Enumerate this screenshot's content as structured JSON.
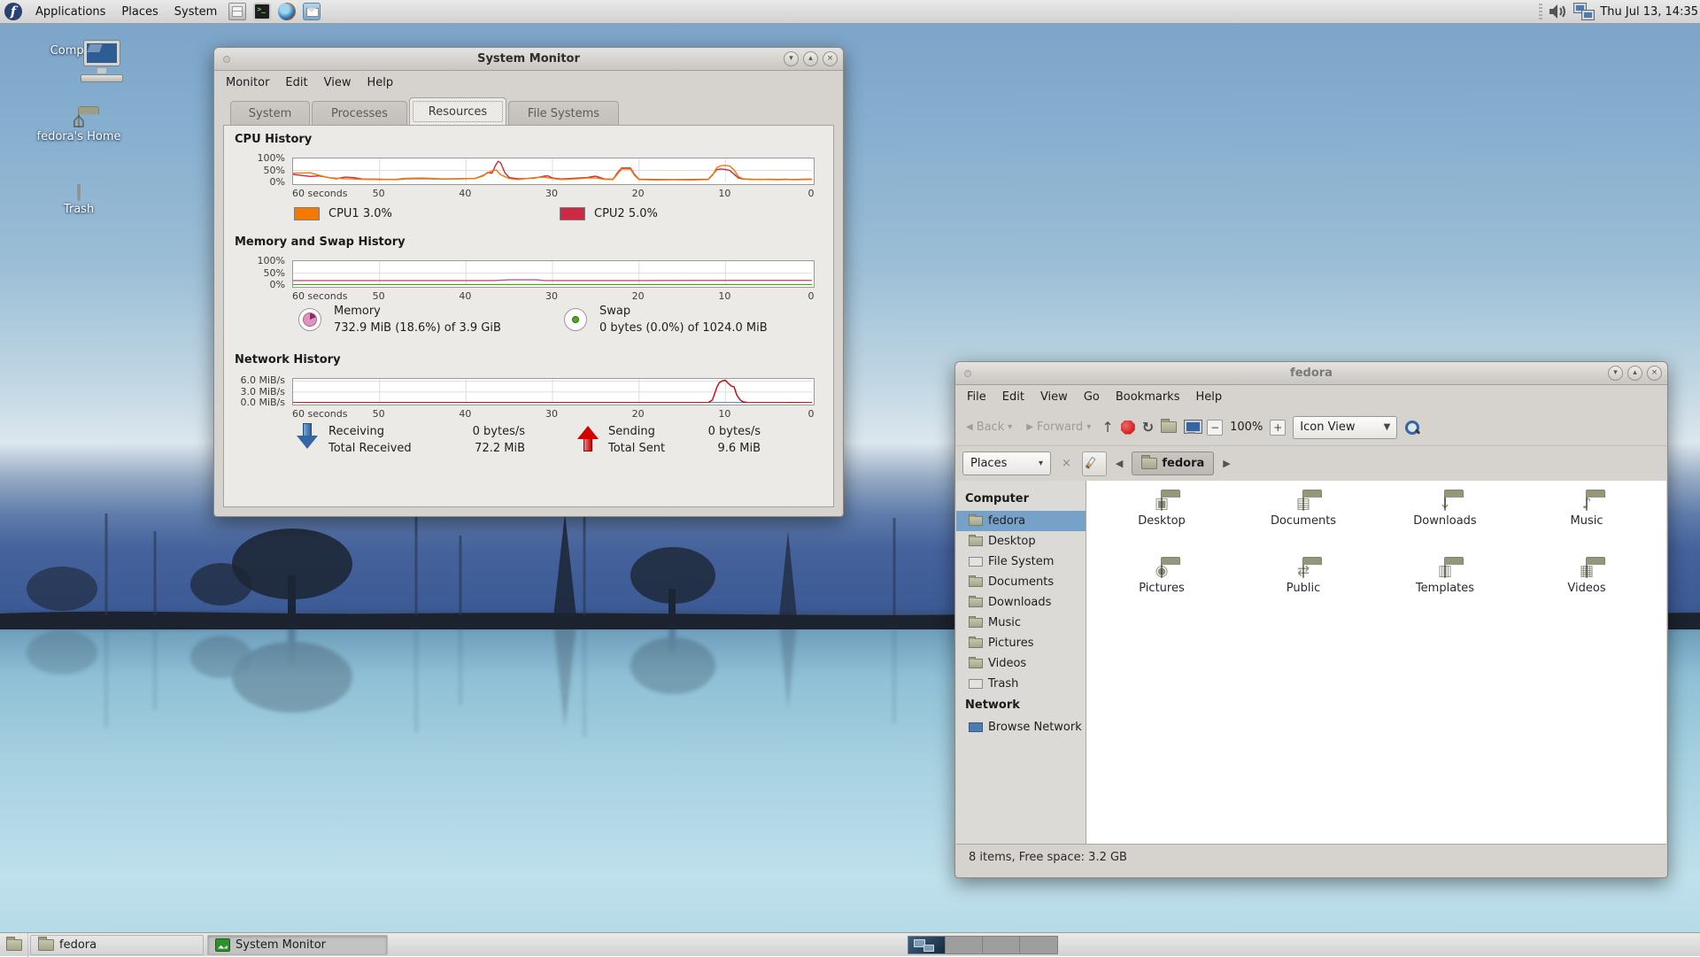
{
  "top_panel": {
    "menus": [
      "Applications",
      "Places",
      "System"
    ],
    "clock": "Thu Jul 13, 14:35"
  },
  "desktop_icons": [
    "Computer",
    "fedora's Home",
    "Trash"
  ],
  "system_monitor": {
    "title": "System Monitor",
    "menus": [
      "Monitor",
      "Edit",
      "View",
      "Help"
    ],
    "tabs": [
      "System",
      "Processes",
      "Resources",
      "File Systems"
    ],
    "active_tab": "Resources",
    "sections": {
      "cpu_heading": "CPU History",
      "cpu_legend": [
        {
          "label": "CPU1 3.0%",
          "color": "#f57900"
        },
        {
          "label": "CPU2 5.0%",
          "color": "#cc2a43"
        }
      ],
      "mem_heading": "Memory and Swap History",
      "memory_label": "Memory",
      "memory_value": "732.9 MiB (18.6%) of 3.9 GiB",
      "swap_label": "Swap",
      "swap_value": "0 bytes (0.0%) of 1024.0 MiB",
      "net_heading": "Network History",
      "receiving_label": "Receiving",
      "receiving_value": "0 bytes/s",
      "total_received_label": "Total Received",
      "total_received_value": "72.2 MiB",
      "sending_label": "Sending",
      "sending_value": "0 bytes/s",
      "total_sent_label": "Total Sent",
      "total_sent_value": "9.6 MiB"
    }
  },
  "chart_data": [
    {
      "id": "cpu-chart",
      "type": "line",
      "title": "CPU History",
      "x_range": [
        60,
        0
      ],
      "ylim": [
        0,
        100
      ],
      "grid_y": [
        50
      ],
      "x_ticks": [
        [
          60,
          "60 seconds"
        ],
        [
          50,
          "50"
        ],
        [
          40,
          "40"
        ],
        [
          30,
          "30"
        ],
        [
          20,
          "20"
        ],
        [
          10,
          "10"
        ],
        [
          0,
          "0"
        ]
      ],
      "y_ticks": [
        [
          100,
          "100%"
        ],
        [
          50,
          "50%"
        ],
        [
          0,
          "0%"
        ]
      ],
      "series": [
        {
          "name": "CPU1",
          "color": "#f57900",
          "points": [
            [
              60,
              38
            ],
            [
              58,
              40
            ],
            [
              57,
              30
            ],
            [
              56,
              20
            ],
            [
              54,
              15
            ],
            [
              52,
              13
            ],
            [
              50,
              12
            ],
            [
              48,
              13
            ],
            [
              47,
              17
            ],
            [
              45,
              18
            ],
            [
              43,
              15
            ],
            [
              41,
              14
            ],
            [
              39,
              16
            ],
            [
              38,
              30
            ],
            [
              37,
              48
            ],
            [
              36.5,
              52
            ],
            [
              36,
              32
            ],
            [
              35,
              16
            ],
            [
              34,
              12
            ],
            [
              33,
              16
            ],
            [
              32,
              20
            ],
            [
              31,
              22
            ],
            [
              30,
              16
            ],
            [
              29,
              12
            ],
            [
              27,
              15
            ],
            [
              26,
              18
            ],
            [
              25,
              18
            ],
            [
              24,
              13
            ],
            [
              23,
              12
            ],
            [
              22.5,
              35
            ],
            [
              22,
              56
            ],
            [
              21,
              56
            ],
            [
              20.5,
              28
            ],
            [
              20,
              12
            ],
            [
              18,
              10
            ],
            [
              16,
              11
            ],
            [
              14,
              10
            ],
            [
              12,
              12
            ],
            [
              11.5,
              30
            ],
            [
              11,
              62
            ],
            [
              10.5,
              70
            ],
            [
              10,
              71
            ],
            [
              9.5,
              68
            ],
            [
              9,
              52
            ],
            [
              8.5,
              24
            ],
            [
              8,
              15
            ],
            [
              7,
              12
            ],
            [
              6,
              13
            ],
            [
              5,
              12
            ],
            [
              4,
              11
            ],
            [
              3,
              12
            ],
            [
              2,
              11
            ],
            [
              1,
              12
            ],
            [
              0,
              12
            ]
          ]
        },
        {
          "name": "CPU2",
          "color": "#cc2a43",
          "points": [
            [
              60,
              33
            ],
            [
              58,
              25
            ],
            [
              57,
              27
            ],
            [
              55,
              15
            ],
            [
              54,
              22
            ],
            [
              53,
              20
            ],
            [
              52,
              14
            ],
            [
              50,
              13
            ],
            [
              48,
              12
            ],
            [
              47,
              15
            ],
            [
              45,
              16
            ],
            [
              43,
              14
            ],
            [
              41,
              15
            ],
            [
              39,
              16
            ],
            [
              38,
              28
            ],
            [
              37.5,
              42
            ],
            [
              37,
              38
            ],
            [
              36.6,
              70
            ],
            [
              36.3,
              88
            ],
            [
              36,
              82
            ],
            [
              35.5,
              40
            ],
            [
              35,
              20
            ],
            [
              34,
              15
            ],
            [
              33,
              16
            ],
            [
              32,
              18
            ],
            [
              31,
              26
            ],
            [
              30.5,
              27
            ],
            [
              30,
              18
            ],
            [
              29,
              14
            ],
            [
              28,
              16
            ],
            [
              27,
              18
            ],
            [
              26,
              20
            ],
            [
              25,
              26
            ],
            [
              24.5,
              20
            ],
            [
              24,
              14
            ],
            [
              23,
              13
            ],
            [
              22.5,
              40
            ],
            [
              22,
              60
            ],
            [
              21,
              60
            ],
            [
              20.5,
              32
            ],
            [
              20,
              13
            ],
            [
              18,
              12
            ],
            [
              16,
              12
            ],
            [
              14,
              12
            ],
            [
              12,
              13
            ],
            [
              11.5,
              32
            ],
            [
              11,
              54
            ],
            [
              10.5,
              56
            ],
            [
              10,
              54
            ],
            [
              9.5,
              50
            ],
            [
              9,
              34
            ],
            [
              8.5,
              18
            ],
            [
              8,
              14
            ],
            [
              7,
              13
            ],
            [
              6,
              12
            ],
            [
              5,
              13
            ],
            [
              4,
              12
            ],
            [
              3,
              13
            ],
            [
              2,
              12
            ],
            [
              1,
              13
            ],
            [
              0,
              13
            ]
          ]
        }
      ]
    },
    {
      "id": "mem-chart",
      "type": "line",
      "title": "Memory and Swap History",
      "x_range": [
        60,
        0
      ],
      "ylim": [
        0,
        100
      ],
      "grid_y": [
        50
      ],
      "x_ticks": [
        [
          60,
          "60 seconds"
        ],
        [
          50,
          "50"
        ],
        [
          40,
          "40"
        ],
        [
          30,
          "30"
        ],
        [
          20,
          "20"
        ],
        [
          10,
          "10"
        ],
        [
          0,
          "0"
        ]
      ],
      "y_ticks": [
        [
          100,
          "100%"
        ],
        [
          50,
          "50%"
        ],
        [
          0,
          "0%"
        ]
      ],
      "series": [
        {
          "name": "Memory",
          "color": "#c0558e",
          "points": [
            [
              60,
              19
            ],
            [
              45,
              19
            ],
            [
              40,
              19
            ],
            [
              37,
              19
            ],
            [
              36,
              20
            ],
            [
              35,
              22
            ],
            [
              32,
              22
            ],
            [
              31.5,
              21
            ],
            [
              31,
              19
            ],
            [
              25,
              19
            ],
            [
              20,
              19
            ],
            [
              10,
              19.5
            ],
            [
              0,
              19.5
            ]
          ]
        },
        {
          "name": "Swap",
          "color": "#4e9a06",
          "points": [
            [
              60,
              1.5
            ],
            [
              0,
              1.5
            ]
          ]
        }
      ]
    },
    {
      "id": "net-chart",
      "type": "line",
      "title": "Network History",
      "x_range": [
        60,
        0
      ],
      "ylim": [
        0,
        6.6
      ],
      "grid_y": [
        3,
        6
      ],
      "x_ticks": [
        [
          60,
          "60 seconds"
        ],
        [
          50,
          "50"
        ],
        [
          40,
          "40"
        ],
        [
          30,
          "30"
        ],
        [
          20,
          "20"
        ],
        [
          10,
          "10"
        ],
        [
          0,
          "0"
        ]
      ],
      "y_ticks": [
        [
          6,
          "6.0 MiB/s"
        ],
        [
          3,
          "3.0 MiB/s"
        ],
        [
          0,
          "0.0 MiB/s"
        ]
      ],
      "series": [
        {
          "name": "Sending",
          "color": "#d40000",
          "points": [
            [
              60,
              0.06
            ],
            [
              12,
              0.06
            ],
            [
              11.5,
              0.8
            ],
            [
              11,
              4.3
            ],
            [
              10.7,
              5.6
            ],
            [
              10.3,
              6.1
            ],
            [
              10,
              6.2
            ],
            [
              9.7,
              5.4
            ],
            [
              9.3,
              4.6
            ],
            [
              9,
              4.4
            ],
            [
              8.7,
              2.2
            ],
            [
              8.3,
              0.8
            ],
            [
              8,
              0.3
            ],
            [
              7.5,
              0.08
            ],
            [
              0,
              0.06
            ]
          ]
        },
        {
          "name": "Receiving",
          "color": "#3465a4",
          "points": [
            [
              60,
              0.03
            ],
            [
              0,
              0.03
            ]
          ]
        }
      ]
    }
  ],
  "file_manager": {
    "title": "fedora",
    "menus": [
      "File",
      "Edit",
      "View",
      "Go",
      "Bookmarks",
      "Help"
    ],
    "toolbar": {
      "back": "Back",
      "forward": "Forward",
      "zoom_level": "100%",
      "view_mode": "Icon View"
    },
    "location_bar": {
      "places": "Places",
      "breadcrumb": "fedora"
    },
    "sidebar": {
      "computer_header": "Computer",
      "items": [
        "fedora",
        "Desktop",
        "File System",
        "Documents",
        "Downloads",
        "Music",
        "Pictures",
        "Videos",
        "Trash"
      ],
      "selected": "fedora",
      "network_header": "Network",
      "network_items": [
        "Browse Network"
      ]
    },
    "folders": [
      "Desktop",
      "Documents",
      "Downloads",
      "Music",
      "Pictures",
      "Public",
      "Templates",
      "Videos"
    ],
    "status": "8 items, Free space: 3.2 GB"
  },
  "bottom_panel": {
    "window_buttons": [
      {
        "label": "fedora",
        "active": false
      },
      {
        "label": "System Monitor",
        "active": true
      }
    ],
    "workspaces": 4
  }
}
